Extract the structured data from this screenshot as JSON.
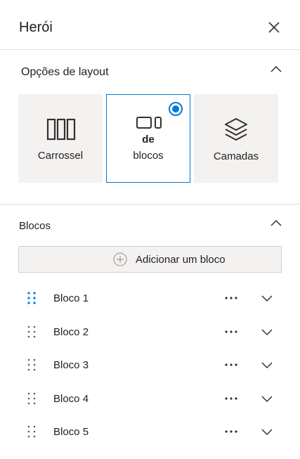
{
  "panel": {
    "title": "Herói",
    "close_icon": "close-icon"
  },
  "layout_section": {
    "title": "Opções de layout",
    "options": [
      {
        "label": "Carrossel",
        "icon": "carousel-icon",
        "selected": false
      },
      {
        "label_line1": "de",
        "label_line2": "blocos",
        "icon": "tiles-icon",
        "selected": true
      },
      {
        "label": "Camadas",
        "icon": "layers-icon",
        "selected": false
      }
    ]
  },
  "blocks_section": {
    "title": "Blocos",
    "add_label": "Adicionar um bloco",
    "items": [
      {
        "label": "Bloco 1"
      },
      {
        "label": "Bloco 2"
      },
      {
        "label": "Bloco 3"
      },
      {
        "label": "Bloco 4"
      },
      {
        "label": "Bloco 5"
      }
    ]
  },
  "colors": {
    "accent": "#0078d4",
    "tile_bg": "#f3f2f1",
    "divider": "#e1dfdd"
  }
}
